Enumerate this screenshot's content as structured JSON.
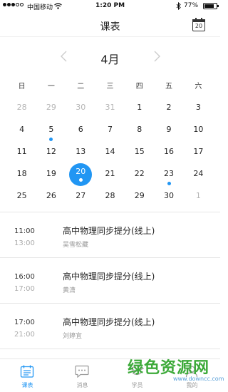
{
  "status": {
    "carrier": "中国移动",
    "time": "1:20 PM",
    "battery": "77%"
  },
  "nav": {
    "title": "课表",
    "calendar_button_day": "20"
  },
  "calendar": {
    "month": "4月",
    "weekdays": [
      "日",
      "一",
      "二",
      "三",
      "四",
      "五",
      "六"
    ],
    "weeks": [
      [
        {
          "d": "28",
          "muted": true
        },
        {
          "d": "29",
          "muted": true
        },
        {
          "d": "30",
          "muted": true
        },
        {
          "d": "31",
          "muted": true
        },
        {
          "d": "1"
        },
        {
          "d": "2"
        },
        {
          "d": "3"
        }
      ],
      [
        {
          "d": "4"
        },
        {
          "d": "5",
          "dot": true
        },
        {
          "d": "6"
        },
        {
          "d": "7"
        },
        {
          "d": "8"
        },
        {
          "d": "9"
        },
        {
          "d": "10"
        }
      ],
      [
        {
          "d": "11"
        },
        {
          "d": "12"
        },
        {
          "d": "13"
        },
        {
          "d": "14"
        },
        {
          "d": "15"
        },
        {
          "d": "16"
        },
        {
          "d": "17"
        }
      ],
      [
        {
          "d": "18"
        },
        {
          "d": "19"
        },
        {
          "d": "20",
          "selected": true,
          "dot": true
        },
        {
          "d": "21"
        },
        {
          "d": "22"
        },
        {
          "d": "23",
          "dot": true
        },
        {
          "d": "24"
        }
      ],
      [
        {
          "d": "25"
        },
        {
          "d": "26"
        },
        {
          "d": "27"
        },
        {
          "d": "28"
        },
        {
          "d": "29"
        },
        {
          "d": "30"
        },
        {
          "d": "1",
          "muted": true
        }
      ]
    ],
    "selected_day": "20"
  },
  "courses": [
    {
      "start": "11:00",
      "end": "13:00",
      "title": "高中物理同步提分(线上)",
      "teacher": "吴雪松藏"
    },
    {
      "start": "16:00",
      "end": "17:00",
      "title": "高中物理同步提分(线上)",
      "teacher": "黄潇"
    },
    {
      "start": "17:00",
      "end": "21:00",
      "title": "高中物理同步提分(线上)",
      "teacher": "刘婷宜"
    }
  ],
  "tabs": [
    {
      "label": "课表",
      "icon": "schedule-icon",
      "active": true
    },
    {
      "label": "消息",
      "icon": "message-icon",
      "active": false
    },
    {
      "label": "学员",
      "icon": "student-icon",
      "active": false
    },
    {
      "label": "我的",
      "icon": "profile-icon",
      "active": false
    }
  ],
  "watermark": {
    "text": "绿色资源网",
    "url": "www.downcc.com"
  },
  "colors": {
    "accent": "#2196f3",
    "muted": "#b5b5b5",
    "watermark_green": "#3daa3a"
  }
}
